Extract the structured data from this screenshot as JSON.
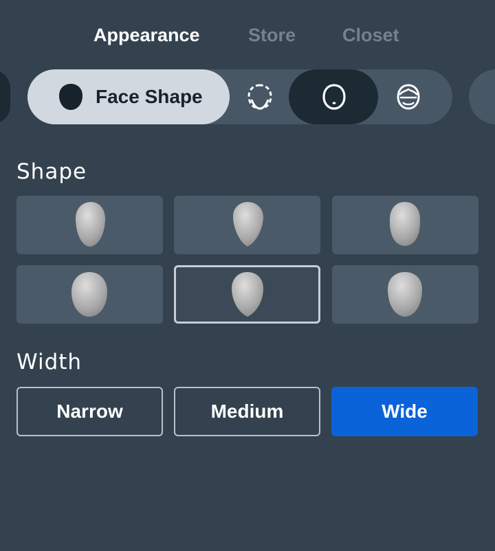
{
  "top_tabs": [
    {
      "label": "Appearance",
      "active": true
    },
    {
      "label": "Store",
      "active": false
    },
    {
      "label": "Closet",
      "active": false
    }
  ],
  "categories": {
    "active_label": "Face Shape",
    "icons": [
      "face-shape-icon",
      "jaw-outline-icon",
      "head-outline-icon",
      "hairline-head-icon"
    ]
  },
  "sections": {
    "shape_label": "Shape",
    "width_label": "Width"
  },
  "shape_options": {
    "count": 6,
    "selected_index": 4
  },
  "width_options": [
    {
      "label": "Narrow",
      "active": false
    },
    {
      "label": "Medium",
      "active": false
    },
    {
      "label": "Wide",
      "active": true
    }
  ],
  "colors": {
    "background": "#33424e",
    "tile": "#4a5a69",
    "accent": "#0a63d8",
    "active_pill": "#d2d8df",
    "dark_pill": "#1c2a34"
  }
}
